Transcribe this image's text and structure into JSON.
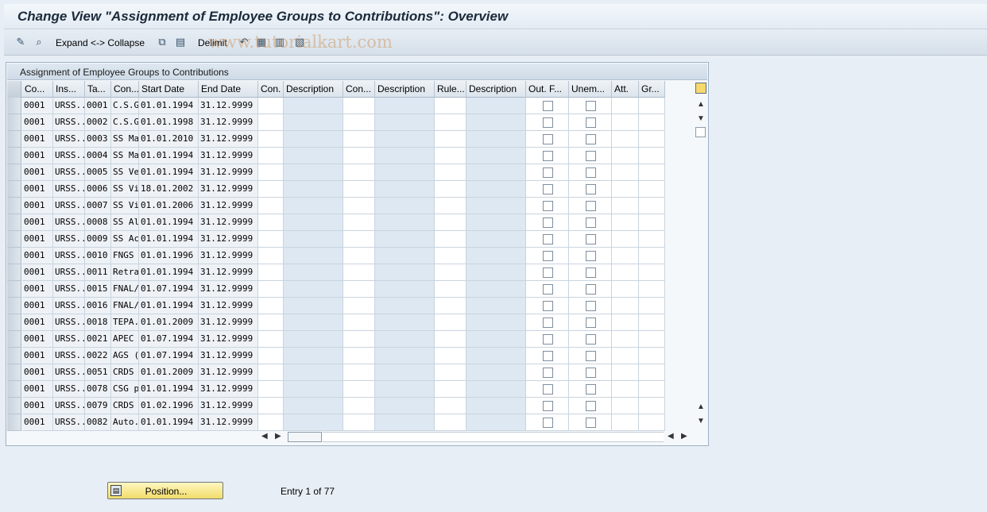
{
  "title": "Change View \"Assignment of Employee Groups to Contributions\": Overview",
  "toolbar": {
    "expand_collapse_label": "Expand <-> Collapse",
    "delimit_label": "Delimit",
    "watermark": "www.tutorialkart.com",
    "icons": [
      "edit-pencil-icon",
      "search-icon",
      "copy-icon",
      "delete-icon",
      "undo-icon",
      "select-all-icon",
      "select-block-icon",
      "deselect-all-icon"
    ]
  },
  "panel_title": "Assignment of Employee Groups to Contributions",
  "columns": [
    "Co...",
    "Ins...",
    "Ta...",
    "Con...",
    "Start Date",
    "End Date",
    "Con.",
    "Description",
    "Con...",
    "Description",
    "Rule...",
    "Description",
    "Out. F...",
    "Unem...",
    "Att.",
    "Gr..."
  ],
  "rows": [
    {
      "co": "0001",
      "ins": "URSS..",
      "ta": "0001",
      "con": "C.S.G..",
      "start": "01.01.1994",
      "end": "31.12.9999"
    },
    {
      "co": "0001",
      "ins": "URSS..",
      "ta": "0002",
      "con": "C.S.G..",
      "start": "01.01.1998",
      "end": "31.12.9999"
    },
    {
      "co": "0001",
      "ins": "URSS..",
      "ta": "0003",
      "con": "SS Ma..",
      "start": "01.01.2010",
      "end": "31.12.9999"
    },
    {
      "co": "0001",
      "ins": "URSS..",
      "ta": "0004",
      "con": "SS Ma..",
      "start": "01.01.1994",
      "end": "31.12.9999"
    },
    {
      "co": "0001",
      "ins": "URSS..",
      "ta": "0005",
      "con": "SS Ve..",
      "start": "01.01.1994",
      "end": "31.12.9999"
    },
    {
      "co": "0001",
      "ins": "URSS..",
      "ta": "0006",
      "con": "SS Vi..",
      "start": "18.01.2002",
      "end": "31.12.9999"
    },
    {
      "co": "0001",
      "ins": "URSS..",
      "ta": "0007",
      "con": "SS Vi..",
      "start": "01.01.2006",
      "end": "31.12.9999"
    },
    {
      "co": "0001",
      "ins": "URSS..",
      "ta": "0008",
      "con": "SS All..",
      "start": "01.01.1994",
      "end": "31.12.9999"
    },
    {
      "co": "0001",
      "ins": "URSS..",
      "ta": "0009",
      "con": "SS Ac..",
      "start": "01.01.1994",
      "end": "31.12.9999"
    },
    {
      "co": "0001",
      "ins": "URSS..",
      "ta": "0010",
      "con": "FNGS",
      "start": "01.01.1996",
      "end": "31.12.9999"
    },
    {
      "co": "0001",
      "ins": "URSS..",
      "ta": "0011",
      "con": "Retrai..",
      "start": "01.01.1994",
      "end": "31.12.9999"
    },
    {
      "co": "0001",
      "ins": "URSS..",
      "ta": "0015",
      "con": "FNAL/..",
      "start": "01.07.1994",
      "end": "31.12.9999"
    },
    {
      "co": "0001",
      "ins": "URSS..",
      "ta": "0016",
      "con": "FNAL/..",
      "start": "01.01.1994",
      "end": "31.12.9999"
    },
    {
      "co": "0001",
      "ins": "URSS..",
      "ta": "0018",
      "con": "TEPA..",
      "start": "01.01.2009",
      "end": "31.12.9999"
    },
    {
      "co": "0001",
      "ins": "URSS..",
      "ta": "0021",
      "con": "APEC",
      "start": "01.07.1994",
      "end": "31.12.9999"
    },
    {
      "co": "0001",
      "ins": "URSS..",
      "ta": "0022",
      "con": "AGS (..",
      "start": "01.07.1994",
      "end": "31.12.9999"
    },
    {
      "co": "0001",
      "ins": "URSS..",
      "ta": "0051",
      "con": "CRDS",
      "start": "01.01.2009",
      "end": "31.12.9999"
    },
    {
      "co": "0001",
      "ins": "URSS..",
      "ta": "0078",
      "con": "CSG p..",
      "start": "01.01.1994",
      "end": "31.12.9999"
    },
    {
      "co": "0001",
      "ins": "URSS..",
      "ta": "0079",
      "con": "CRDS",
      "start": "01.02.1996",
      "end": "31.12.9999"
    },
    {
      "co": "0001",
      "ins": "URSS..",
      "ta": "0082",
      "con": "Auto..",
      "start": "01.01.1994",
      "end": "31.12.9999"
    }
  ],
  "position_button_label": "Position...",
  "entry_text": "Entry 1 of 77",
  "colors": {
    "accent": "#f1dc6a",
    "description_cell": "#dde8f2",
    "background": "#e8eef5"
  }
}
